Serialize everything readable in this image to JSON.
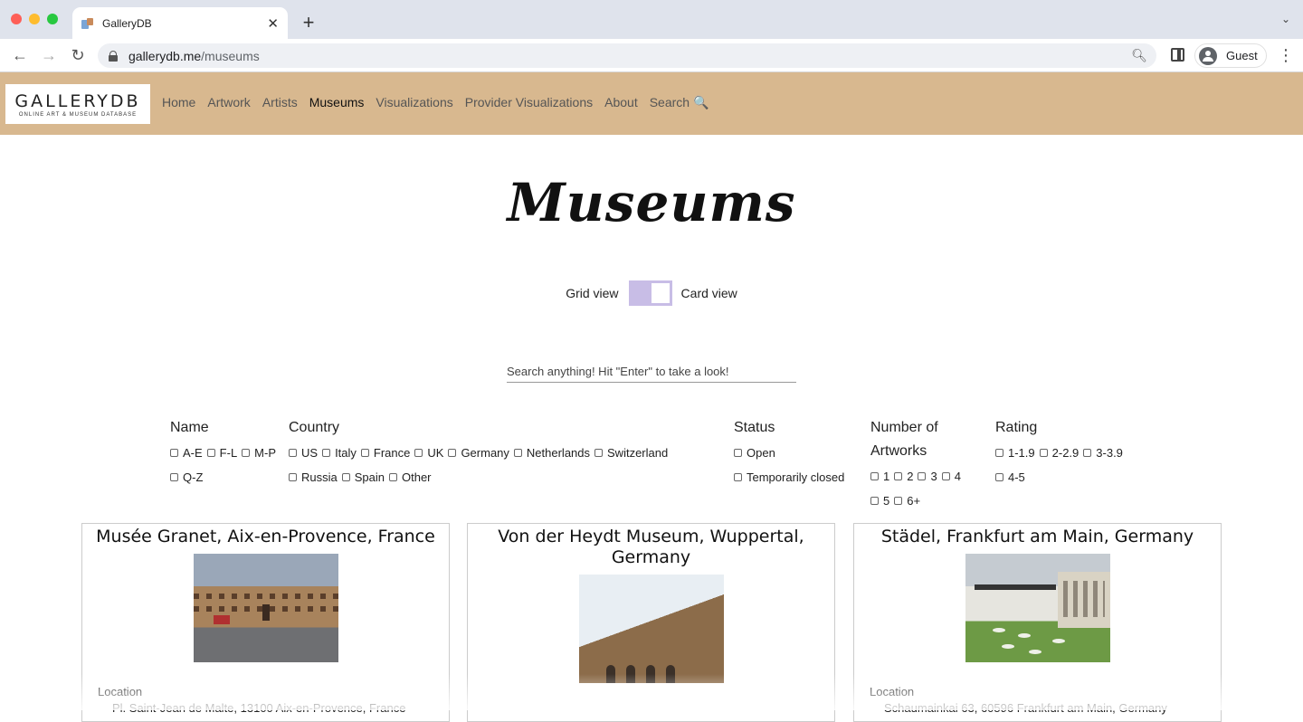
{
  "browser": {
    "tab_title": "GalleryDB",
    "new_tab": "+",
    "url_host": "gallerydb.me",
    "url_path": "/museums",
    "profile_name": "Guest"
  },
  "site": {
    "logo_main": "GALLERYDB",
    "logo_sub": "ONLINE ART & MUSEUM DATABASE",
    "nav": {
      "home": "Home",
      "artwork": "Artwork",
      "artists": "Artists",
      "museums": "Museums",
      "visualizations": "Visualizations",
      "provider": "Provider Visualizations",
      "about": "About",
      "search": "Search 🔍"
    }
  },
  "page": {
    "title": "Museums",
    "grid_view": "Grid view",
    "card_view": "Card view",
    "search_placeholder": "Search anything! Hit \"Enter\" to take a look!"
  },
  "filters": {
    "name": {
      "title": "Name",
      "options": [
        "A-E",
        "F-L",
        "M-P",
        "Q-Z"
      ]
    },
    "country": {
      "title": "Country",
      "options": [
        "US",
        "Italy",
        "France",
        "UK",
        "Germany",
        "Netherlands",
        "Switzerland",
        "Russia",
        "Spain",
        "Other"
      ]
    },
    "status": {
      "title": "Status",
      "options": [
        "Open",
        "Temporarily closed"
      ]
    },
    "artworks": {
      "title": "Number of Artworks",
      "options": [
        "1",
        "2",
        "3",
        "4",
        "5",
        "6+"
      ]
    },
    "rating": {
      "title": "Rating",
      "options": [
        "1-1.9",
        "2-2.9",
        "3-3.9",
        "4-5"
      ]
    }
  },
  "cards": [
    {
      "title": "Musée Granet, Aix-en-Provence, France",
      "location_label": "Location",
      "location": "Pl. Saint-Jean de Malte, 13100 Aix-en-Provence, France"
    },
    {
      "title": "Von der Heydt Museum, Wuppertal, Germany",
      "location_label": "",
      "location": ""
    },
    {
      "title": "Städel, Frankfurt am Main, Germany",
      "location_label": "Location",
      "location": "Schaumainkai 63, 60596 Frankfurt am Main, Germany"
    }
  ]
}
